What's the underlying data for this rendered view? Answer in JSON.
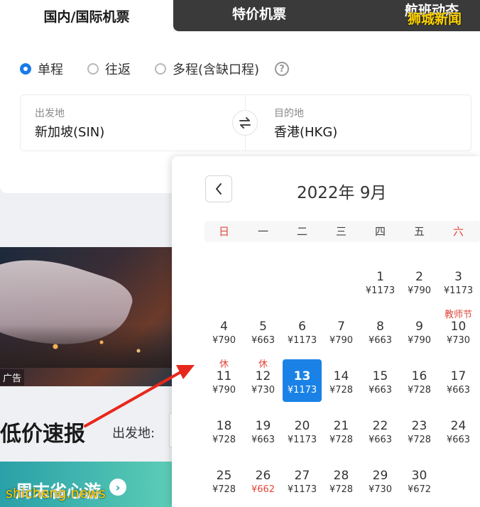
{
  "tabs": {
    "domestic_intl": "国内/国际机票",
    "special": "特价机票",
    "flight_status": "航班动态"
  },
  "watermark_top": "狮城新闻",
  "trip_types": [
    {
      "label": "单程",
      "checked": true
    },
    {
      "label": "往返",
      "checked": false
    },
    {
      "label": "多程(含缺口程)",
      "checked": false
    }
  ],
  "route": {
    "from_label": "出发地",
    "from_value": "新加坡(SIN)",
    "to_label": "目的地",
    "to_value": "香港(HKG)"
  },
  "ad_tag": "广告",
  "deals": {
    "title": "低价速报",
    "from_label": "出发地:"
  },
  "weekend": {
    "label": "周末省心游"
  },
  "watermark_bottom": "shicheng.news",
  "calendar": {
    "title": "2022年 9月",
    "weekdays": [
      "日",
      "一",
      "二",
      "三",
      "四",
      "五",
      "六"
    ],
    "days": [
      {
        "d": "1",
        "price": "¥1173",
        "tag": ""
      },
      {
        "d": "2",
        "price": "¥790",
        "tag": ""
      },
      {
        "d": "3",
        "price": "¥1173",
        "tag": ""
      },
      {
        "d": "4",
        "price": "¥790",
        "tag": ""
      },
      {
        "d": "5",
        "price": "¥663",
        "tag": ""
      },
      {
        "d": "6",
        "price": "¥1173",
        "tag": ""
      },
      {
        "d": "7",
        "price": "¥790",
        "tag": ""
      },
      {
        "d": "8",
        "price": "¥663",
        "tag": ""
      },
      {
        "d": "9",
        "price": "¥790",
        "tag": ""
      },
      {
        "d": "10",
        "price": "¥730",
        "tag": "教师节"
      },
      {
        "d": "11",
        "price": "¥790",
        "tag": "休"
      },
      {
        "d": "12",
        "price": "¥730",
        "tag": "休"
      },
      {
        "d": "13",
        "price": "¥1173",
        "tag": "",
        "selected": true
      },
      {
        "d": "14",
        "price": "¥728",
        "tag": ""
      },
      {
        "d": "15",
        "price": "¥663",
        "tag": ""
      },
      {
        "d": "16",
        "price": "¥728",
        "tag": ""
      },
      {
        "d": "17",
        "price": "¥663",
        "tag": ""
      },
      {
        "d": "18",
        "price": "¥728",
        "tag": ""
      },
      {
        "d": "19",
        "price": "¥663",
        "tag": ""
      },
      {
        "d": "20",
        "price": "¥1173",
        "tag": ""
      },
      {
        "d": "21",
        "price": "¥728",
        "tag": ""
      },
      {
        "d": "22",
        "price": "¥663",
        "tag": ""
      },
      {
        "d": "23",
        "price": "¥728",
        "tag": ""
      },
      {
        "d": "24",
        "price": "¥663",
        "tag": ""
      },
      {
        "d": "25",
        "price": "¥728",
        "tag": ""
      },
      {
        "d": "26",
        "price": "¥662",
        "tag": "",
        "lowest": true
      },
      {
        "d": "27",
        "price": "¥1173",
        "tag": ""
      },
      {
        "d": "28",
        "price": "¥728",
        "tag": ""
      },
      {
        "d": "29",
        "price": "¥730",
        "tag": ""
      },
      {
        "d": "30",
        "price": "¥672",
        "tag": ""
      }
    ]
  },
  "colors": {
    "accent": "#1a82e6",
    "holiday_red": "#e0473c",
    "watermark": "#ffd400",
    "arrow": "#e8271c"
  }
}
